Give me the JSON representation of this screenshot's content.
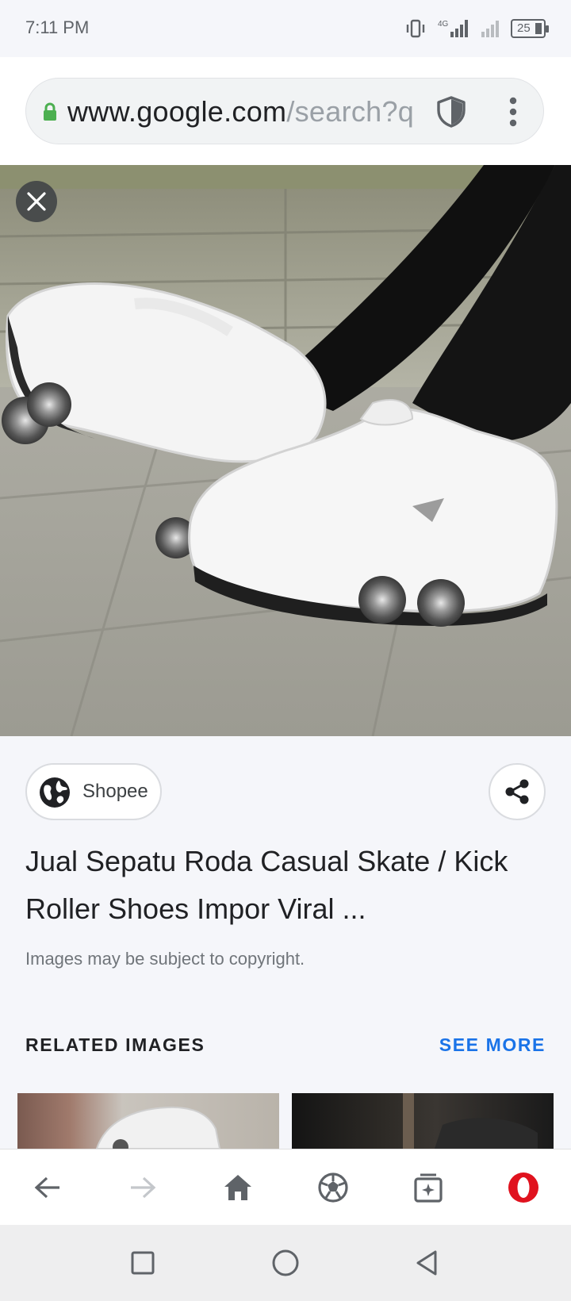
{
  "status_bar": {
    "time": "7:11 PM",
    "network": "4G",
    "battery": "25"
  },
  "address_bar": {
    "url_host": "www.google.com",
    "url_path": "/search?q"
  },
  "result": {
    "source": "Shopee",
    "title": "Jual Sepatu Roda Casual Skate / Kick Roller Shoes Impor Viral ...",
    "copyright_note": "Images may be subject to copyright."
  },
  "related": {
    "header": "RELATED IMAGES",
    "see_more": "SEE MORE"
  },
  "colors": {
    "accent": "#1a73e8",
    "opera_red": "#e0121e",
    "lock_green": "#4caf50"
  },
  "icons": {
    "close": "close-icon",
    "share": "share-icon",
    "globe": "globe-icon",
    "shield": "shield-icon",
    "menu": "more-vert-icon",
    "back": "arrow-left-icon",
    "forward": "arrow-right-icon",
    "home": "home-icon",
    "discover": "soccer-ball-icon",
    "tabs": "tabs-icon",
    "opera": "opera-logo-icon"
  }
}
